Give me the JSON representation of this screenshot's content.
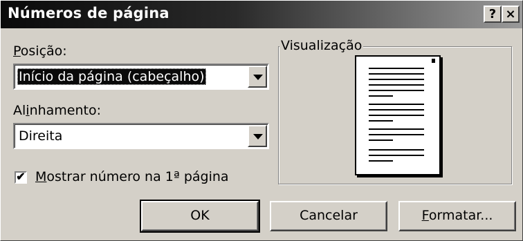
{
  "dialog": {
    "title": "Números de página",
    "help_button": "?",
    "close_button": "×"
  },
  "position": {
    "label_first": "P",
    "label_rest": "osição:",
    "value": "Início da página (cabeçalho)"
  },
  "alignment": {
    "label_first": "Al",
    "label_underlined": "i",
    "label_rest": "nhamento:",
    "value": "Direita"
  },
  "show_first_page": {
    "checked": true,
    "check_mark": "✔",
    "label_first": "M",
    "label_rest": "ostrar número na 1ª página"
  },
  "preview": {
    "label": "Visualização"
  },
  "buttons": {
    "ok": "OK",
    "cancel": "Cancelar",
    "format_first": "F",
    "format_rest": "ormatar..."
  }
}
